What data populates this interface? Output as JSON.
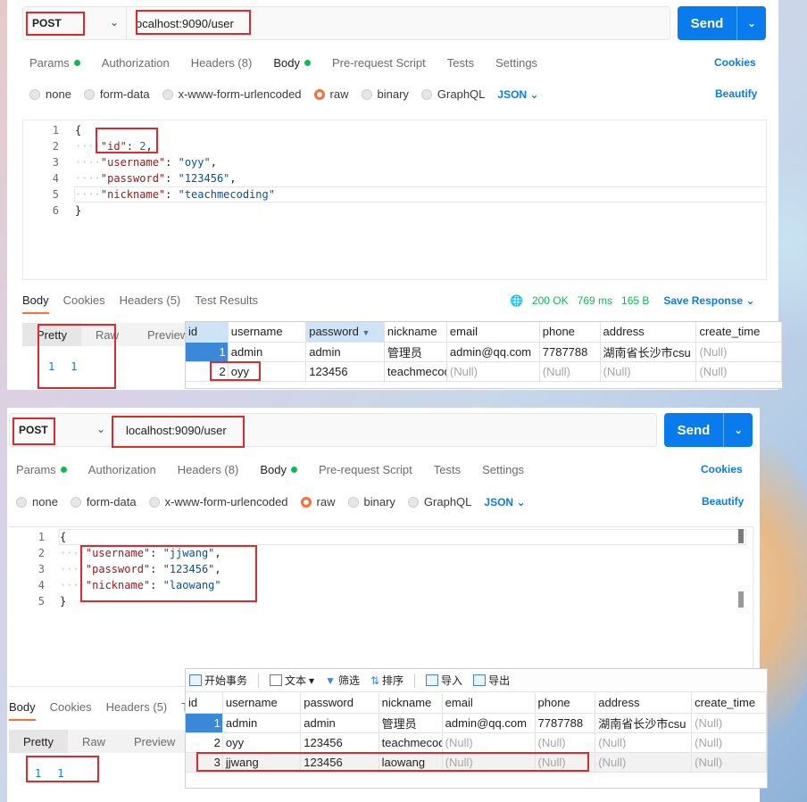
{
  "top": {
    "method": "POST",
    "url": "ocalhost:9090/user",
    "send": "Send",
    "tabs": {
      "params": "Params",
      "authorization": "Authorization",
      "headers": "Headers (8)",
      "body": "Body",
      "prerequest": "Pre-request Script",
      "tests": "Tests",
      "settings": "Settings"
    },
    "cookies": "Cookies",
    "body_types": {
      "none": "none",
      "form_data": "form-data",
      "urlencoded": "x-www-form-urlencoded",
      "raw": "raw",
      "binary": "binary",
      "graphql": "GraphQL"
    },
    "json_type": "JSON",
    "beautify": "Beautify",
    "lines": [
      "1",
      "2",
      "3",
      "4",
      "5",
      "6"
    ],
    "code": {
      "l1": "{",
      "l2_key": "\"id\"",
      "l2_val": "2",
      "l3_key": "\"username\"",
      "l3_val": "\"oyy\"",
      "l4_key": "\"password\"",
      "l4_val": "\"123456\"",
      "l5_key": "\"nickname\"",
      "l5_val": "\"teachmecoding\"",
      "l6": "}"
    },
    "response": {
      "tabs": {
        "body": "Body",
        "cookies": "Cookies",
        "headers": "Headers (5)",
        "results": "Test Results"
      },
      "status": "200 OK",
      "time": "769 ms",
      "size": "165 B",
      "save": "Save Response",
      "formats": {
        "pretty": "Pretty",
        "raw": "Raw",
        "preview": "Preview"
      },
      "line": "1",
      "value": "1"
    },
    "grid": {
      "headers": [
        "id",
        "username",
        "password",
        "nickname",
        "email",
        "phone",
        "address",
        "create_time"
      ],
      "rows": [
        [
          "1",
          "admin",
          "admin",
          "管理员",
          "admin@qq.com",
          "7787788",
          "湖南省长沙市csu",
          "(Null)"
        ],
        [
          "2",
          "oyy",
          "123456",
          "teachmecoding",
          "(Null)",
          "(Null)",
          "(Null)",
          "(Null)"
        ]
      ]
    }
  },
  "bottom": {
    "method": "POST",
    "url": "localhost:9090/user",
    "send": "Send",
    "tabs": {
      "params": "Params",
      "authorization": "Authorization",
      "headers": "Headers (8)",
      "body": "Body",
      "prerequest": "Pre-request Script",
      "tests": "Tests",
      "settings": "Settings"
    },
    "cookies": "Cookies",
    "body_types": {
      "none": "none",
      "form_data": "form-data",
      "urlencoded": "x-www-form-urlencoded",
      "raw": "raw",
      "binary": "binary",
      "graphql": "GraphQL"
    },
    "json_type": "JSON",
    "beautify": "Beautify",
    "lines": [
      "1",
      "2",
      "3",
      "4",
      "5"
    ],
    "code": {
      "l1": "{",
      "l2_key": "\"username\"",
      "l2_val": "\"jjwang\"",
      "l3_key": "\"password\"",
      "l3_val": "\"123456\"",
      "l4_key": "\"nickname\"",
      "l4_val": "\"laowang\"",
      "l5": "}"
    },
    "response": {
      "tabs": {
        "body": "Body",
        "cookies": "Cookies",
        "headers": "Headers (5)",
        "results": "T"
      },
      "formats": {
        "pretty": "Pretty",
        "raw": "Raw",
        "preview": "Preview"
      },
      "line": "1",
      "value": "1"
    },
    "grid": {
      "toolbar": {
        "begin": "开始事务",
        "text": "文本",
        "filter": "筛选",
        "sort": "排序",
        "import": "导入",
        "export": "导出"
      },
      "headers": [
        "id",
        "username",
        "password",
        "nickname",
        "email",
        "phone",
        "address",
        "create_time"
      ],
      "rows": [
        [
          "1",
          "admin",
          "admin",
          "管理员",
          "admin@qq.com",
          "7787788",
          "湖南省长沙市csu",
          "(Null)"
        ],
        [
          "2",
          "oyy",
          "123456",
          "teachmecoding",
          "(Null)",
          "(Null)",
          "(Null)",
          "(Null)"
        ],
        [
          "3",
          "jjwang",
          "123456",
          "laowang",
          "(Null)",
          "(Null)",
          "(Null)",
          "(Null)"
        ]
      ]
    }
  }
}
